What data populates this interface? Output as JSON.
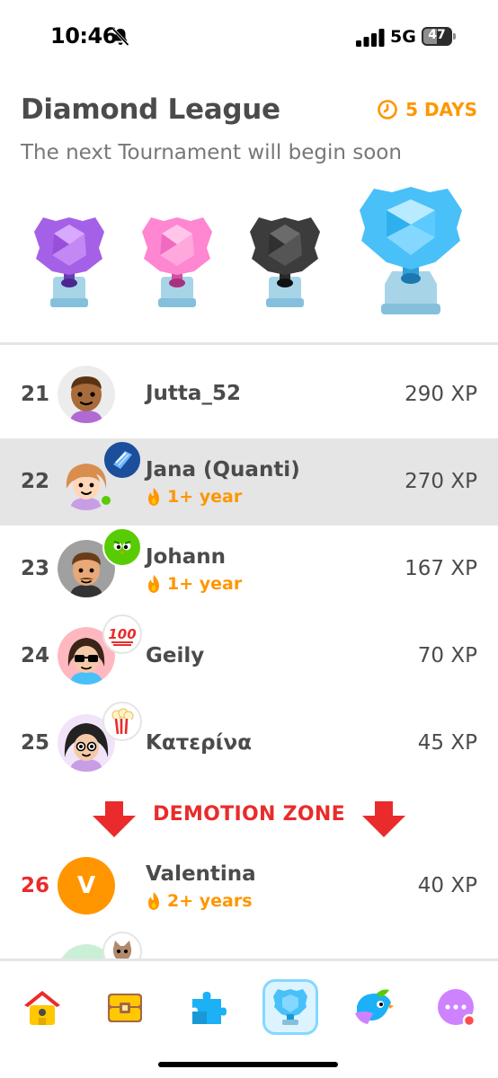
{
  "status_bar": {
    "time": "10:46",
    "network": "5G",
    "battery": "47"
  },
  "header": {
    "title": "Diamond League",
    "timer_label": "5 DAYS",
    "subtitle": "The next Tournament will begin soon"
  },
  "trophies": [
    {
      "name": "amethyst",
      "color": "#a560e8"
    },
    {
      "name": "pearl",
      "color": "#ff86d0"
    },
    {
      "name": "obsidian",
      "color": "#4b4b4b"
    },
    {
      "name": "diamond",
      "color": "#49c0f8",
      "active": true
    }
  ],
  "leaderboard": [
    {
      "rank": "21",
      "name": "Jutta_52",
      "xp": "290 XP"
    },
    {
      "rank": "22",
      "name": "Jana (Quanti)",
      "streak": "1+ year",
      "xp": "270 XP",
      "highlighted": true
    },
    {
      "rank": "23",
      "name": "Johann",
      "streak": "1+ year",
      "xp": "167 XP"
    },
    {
      "rank": "24",
      "name": "Geily",
      "xp": "70 XP",
      "badge_text": "100"
    },
    {
      "rank": "25",
      "name": "Κατερίνα",
      "xp": "45 XP"
    },
    {
      "rank": "26",
      "name": "Valentina",
      "streak": "2+ years",
      "xp": "40 XP",
      "avatar_letter": "V",
      "demoted": true
    }
  ],
  "demotion_label": "DEMOTION ZONE",
  "colors": {
    "accent_orange": "#ff9600",
    "demotion_red": "#ea2b2b",
    "text": "#4b4b4b",
    "highlight": "#e5e5e5"
  },
  "nav": [
    "home-icon",
    "chest-icon",
    "puzzle-icon",
    "leagues-icon",
    "bird-icon",
    "more-icon"
  ]
}
